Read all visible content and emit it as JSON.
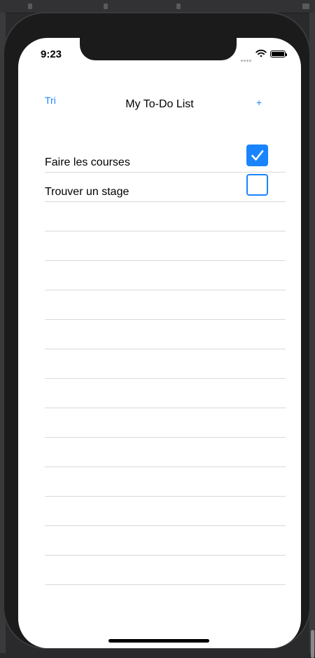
{
  "status_bar": {
    "time": "9:23"
  },
  "nav": {
    "left_label": "Tri",
    "title": "My To-Do List",
    "right_label": "+"
  },
  "todos": [
    {
      "label": "Faire les courses",
      "done": true
    },
    {
      "label": "Trouver un stage",
      "done": false
    }
  ],
  "colors": {
    "accent": "#1a84ff",
    "separator": "#d9d9d9",
    "device_frame": "#1b1b1b"
  },
  "icons": [
    "wifi-icon",
    "battery-icon",
    "checkmark-icon",
    "plus-icon"
  ]
}
